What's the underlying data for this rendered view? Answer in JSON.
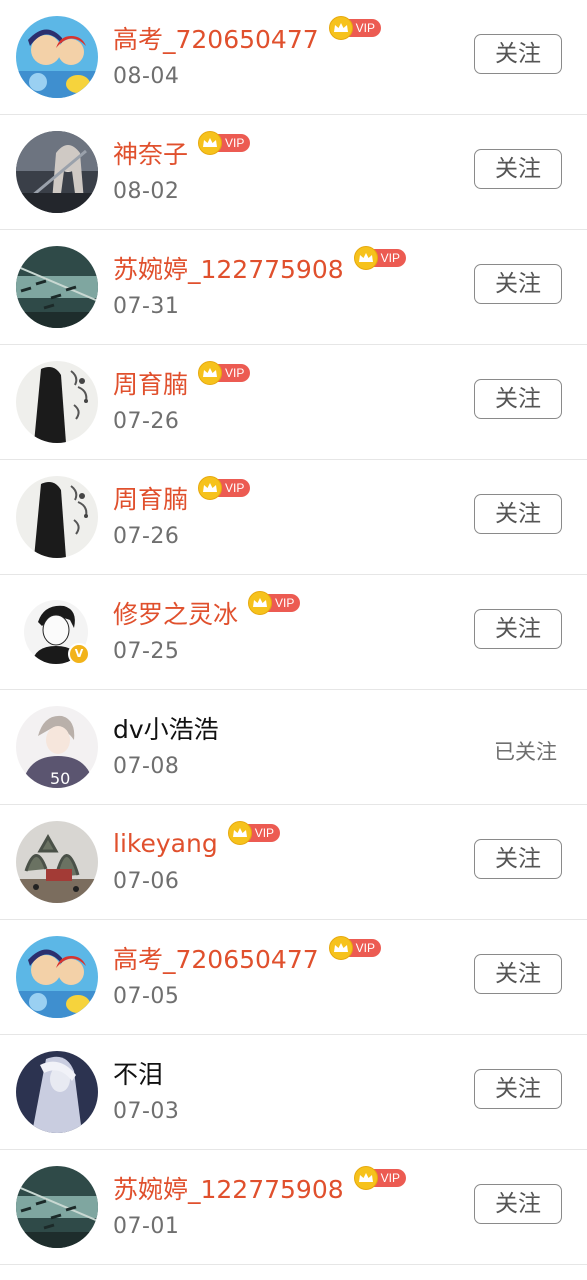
{
  "labels": {
    "vip": "VIP",
    "follow": "关注",
    "followed": "已关注",
    "verified_badge": "V"
  },
  "colors": {
    "vip_name": "#e0502d",
    "plain_name": "#111111",
    "date": "#6f6f6f",
    "vip_tag": "#ec5b52",
    "crown": "#f6c21c"
  },
  "items": [
    {
      "name": "高考_720650477",
      "date": "08-04",
      "vip": true,
      "followed": false
    },
    {
      "name": "神奈子",
      "date": "08-02",
      "vip": true,
      "followed": false
    },
    {
      "name": "苏婉婷_122775908",
      "date": "07-31",
      "vip": true,
      "followed": false
    },
    {
      "name": "周育腩",
      "date": "07-26",
      "vip": true,
      "followed": false
    },
    {
      "name": "周育腩",
      "date": "07-26",
      "vip": true,
      "followed": false
    },
    {
      "name": "修罗之灵冰",
      "date": "07-25",
      "vip": true,
      "followed": false,
      "verified": true
    },
    {
      "name": "dv小浩浩",
      "date": "07-08",
      "vip": false,
      "followed": true
    },
    {
      "name": "likeyang",
      "date": "07-06",
      "vip": true,
      "followed": false
    },
    {
      "name": "高考_720650477",
      "date": "07-05",
      "vip": true,
      "followed": false
    },
    {
      "name": "不泪",
      "date": "07-03",
      "vip": false,
      "followed": false
    },
    {
      "name": "苏婉婷_122775908",
      "date": "07-01",
      "vip": true,
      "followed": false
    }
  ]
}
